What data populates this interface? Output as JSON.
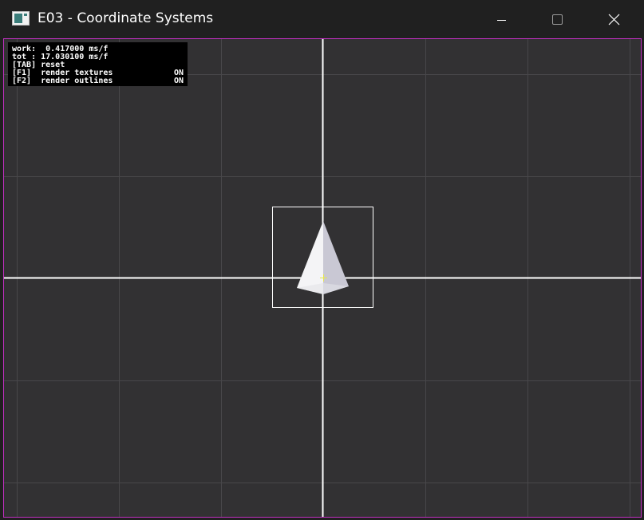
{
  "window": {
    "title": "E03 - Coordinate Systems",
    "app_icon": "app-window-icon",
    "controls": {
      "minimize_icon": "minimize-icon",
      "maximize_icon": "maximize-icon",
      "close_icon": "close-icon"
    },
    "viewport_border_color": "#c02fc0"
  },
  "hud": {
    "lines": [
      {
        "label": "work:  0.417000 ms/f",
        "state": ""
      },
      {
        "label": "tot : 17.030100 ms/f",
        "state": ""
      },
      {
        "label": "[TAB] reset",
        "state": ""
      },
      {
        "label": "[F1]  render textures",
        "state": "ON"
      },
      {
        "label": "[F2]  render outlines",
        "state": "ON"
      }
    ]
  },
  "scene": {
    "background_color": "#323133",
    "grid_color": "#4a494c",
    "axis_color": "#ffffff",
    "origin_marker_color": "#e8e84a",
    "object": "white-pyramid-sprite",
    "selection_outline": "square-outline"
  }
}
